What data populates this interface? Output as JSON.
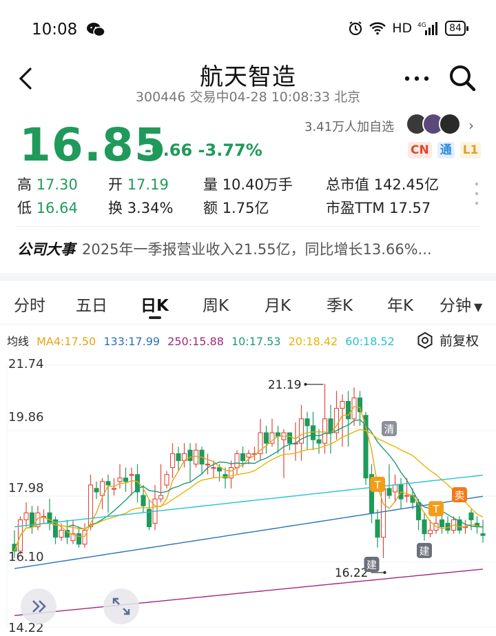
{
  "status_bar": {
    "time": "10:08",
    "network": "HD",
    "battery": "84"
  },
  "header": {
    "title": "航天智造",
    "subtitle": "300446 交易中04-28 10:08:33 北京"
  },
  "quote": {
    "price": "16.85",
    "change": "-0.66 -3.77%",
    "followers": "3.41万人加自选",
    "badges": [
      "CN",
      "通",
      "L1"
    ],
    "metrics": {
      "high_label": "高",
      "high": "17.30",
      "open_label": "开",
      "open": "17.19",
      "volume_label": "量",
      "volume": "10.40万手",
      "mktcap_label": "总市值",
      "mktcap": "142.45亿",
      "low_label": "低",
      "low": "16.64",
      "turnover_label": "换",
      "turnover": "3.34%",
      "amount_label": "额",
      "amount": "1.75亿",
      "pe_label": "市盈TTM",
      "pe": "17.57"
    }
  },
  "news": {
    "tag": "公司大事",
    "text": "2025年一季报营业收入21.55亿，同比增长13.66%..."
  },
  "tabs": [
    "分时",
    "五日",
    "日K",
    "周K",
    "月K",
    "季K",
    "年K",
    "分钟"
  ],
  "active_tab": "日K",
  "ma_legend": {
    "label": "均线",
    "items": [
      {
        "text": "MA4:17.50",
        "color": "#e8a317"
      },
      {
        "text": "133:17.99",
        "color": "#2a73b8"
      },
      {
        "text": "250:15.88",
        "color": "#a3287a"
      },
      {
        "text": "10:17.53",
        "color": "#1a9a7a"
      },
      {
        "text": "20:18.42",
        "color": "#e8b300"
      },
      {
        "text": "60:18.52",
        "color": "#27c2cf"
      }
    ],
    "restore_label": "前复权"
  },
  "chart_data": {
    "type": "candlestick",
    "y_ticks": [
      "21.74",
      "19.86",
      "17.98",
      "16.10",
      "14.22"
    ],
    "ylim": [
      14.22,
      21.74
    ],
    "annotations": [
      {
        "text": "21.19"
      },
      {
        "text": "16.22"
      }
    ],
    "markers": [
      "清",
      "T",
      "T",
      "卖",
      "建",
      "建"
    ],
    "colors": {
      "up": "#e0463a",
      "down": "#1f9a5a"
    },
    "candles": [
      [
        16.6,
        16.4,
        17.0,
        16.2
      ],
      [
        16.4,
        17.3,
        17.4,
        16.3
      ],
      [
        17.3,
        17.5,
        17.8,
        17.1
      ],
      [
        17.5,
        17.1,
        17.7,
        16.9
      ],
      [
        17.1,
        17.5,
        17.7,
        17.0
      ],
      [
        17.4,
        17.4,
        17.6,
        17.2
      ],
      [
        17.5,
        17.2,
        17.9,
        17.0
      ],
      [
        17.3,
        16.8,
        17.4,
        16.6
      ],
      [
        16.8,
        17.0,
        17.2,
        16.7
      ],
      [
        17.0,
        16.8,
        17.3,
        16.6
      ],
      [
        16.7,
        16.9,
        17.3,
        16.6
      ],
      [
        16.9,
        16.6,
        17.1,
        16.5
      ],
      [
        16.6,
        17.0,
        17.2,
        16.5
      ],
      [
        17.1,
        18.3,
        18.6,
        17.0
      ],
      [
        18.2,
        18.1,
        18.4,
        17.9
      ],
      [
        18.0,
        18.4,
        18.5,
        17.6
      ],
      [
        18.4,
        18.3,
        18.6,
        17.5
      ],
      [
        18.2,
        18.2,
        18.5,
        18.0
      ],
      [
        18.4,
        18.5,
        18.9,
        18.2
      ],
      [
        18.5,
        18.4,
        18.8,
        18.1
      ],
      [
        18.6,
        18.6,
        18.8,
        18.0
      ],
      [
        18.6,
        18.1,
        18.9,
        17.8
      ],
      [
        18.0,
        17.7,
        18.3,
        17.5
      ],
      [
        17.6,
        17.1,
        17.9,
        17.0
      ],
      [
        17.2,
        17.9,
        18.3,
        17.0
      ],
      [
        17.9,
        18.0,
        18.9,
        17.8
      ],
      [
        18.3,
        18.6,
        18.7,
        18.2
      ],
      [
        18.8,
        19.2,
        19.5,
        18.5
      ],
      [
        19.2,
        19.0,
        19.4,
        18.7
      ],
      [
        19.0,
        19.2,
        19.5,
        18.8
      ],
      [
        19.3,
        19.0,
        19.5,
        18.4
      ],
      [
        18.9,
        19.3,
        19.5,
        18.8
      ],
      [
        19.3,
        18.9,
        19.4,
        18.6
      ],
      [
        18.9,
        18.9,
        19.2,
        18.6
      ],
      [
        18.8,
        18.8,
        19.0,
        18.5
      ],
      [
        18.8,
        18.7,
        18.9,
        18.4
      ],
      [
        18.6,
        18.5,
        18.8,
        18.2
      ],
      [
        18.5,
        18.8,
        19.0,
        18.2
      ],
      [
        18.8,
        19.2,
        19.3,
        18.6
      ],
      [
        19.2,
        19.0,
        19.4,
        18.8
      ],
      [
        19.1,
        19.2,
        19.3,
        18.9
      ],
      [
        19.2,
        19.2,
        19.4,
        19.0
      ],
      [
        19.2,
        19.8,
        20.2,
        19.0
      ],
      [
        19.8,
        19.5,
        20.0,
        19.2
      ],
      [
        19.5,
        19.8,
        20.2,
        19.4
      ],
      [
        19.8,
        19.7,
        20.0,
        19.2
      ],
      [
        19.6,
        19.8,
        19.9,
        18.5
      ],
      [
        19.8,
        19.5,
        19.8,
        19.3
      ],
      [
        19.5,
        19.5,
        20.1,
        19.0
      ],
      [
        19.5,
        20.2,
        20.6,
        19.0
      ],
      [
        20.2,
        20.0,
        20.4,
        19.3
      ],
      [
        20.0,
        19.6,
        20.4,
        19.3
      ],
      [
        19.6,
        19.5,
        19.9,
        19.2
      ],
      [
        19.5,
        20.2,
        21.2,
        19.2
      ],
      [
        20.2,
        19.8,
        20.6,
        19.2
      ],
      [
        19.8,
        20.5,
        21.0,
        19.6
      ],
      [
        20.5,
        20.7,
        20.9,
        19.4
      ],
      [
        20.7,
        20.2,
        21.0,
        19.4
      ],
      [
        20.2,
        20.8,
        21.1,
        20.0
      ],
      [
        20.8,
        20.4,
        21.0,
        20.0
      ],
      [
        20.3,
        18.5,
        20.4,
        18.3
      ],
      [
        18.6,
        17.5,
        18.9,
        17.2
      ],
      [
        17.3,
        16.8,
        17.6,
        16.5
      ],
      [
        16.8,
        18.2,
        18.4,
        16.2
      ],
      [
        18.2,
        18.0,
        18.9,
        17.9
      ],
      [
        18.1,
        18.3,
        18.6,
        17.8
      ],
      [
        18.3,
        17.9,
        18.5,
        17.6
      ],
      [
        18.0,
        18.0,
        18.5,
        17.8
      ],
      [
        18.0,
        17.8,
        18.2,
        17.6
      ],
      [
        17.8,
        17.3,
        17.9,
        17.0
      ],
      [
        17.3,
        16.9,
        17.5,
        16.7
      ],
      [
        16.9,
        17.0,
        17.3,
        16.8
      ],
      [
        17.0,
        17.2,
        17.5,
        16.9
      ],
      [
        17.3,
        17.1,
        17.5,
        16.9
      ],
      [
        17.2,
        17.0,
        17.4,
        16.9
      ],
      [
        17.0,
        17.3,
        17.4,
        16.9
      ],
      [
        17.3,
        17.0,
        17.4,
        16.9
      ],
      [
        17.1,
        17.1,
        17.3,
        16.9
      ],
      [
        17.5,
        17.3,
        17.6,
        17.0
      ],
      [
        17.2,
        17.1,
        17.4,
        16.9
      ],
      [
        16.9,
        16.85,
        17.3,
        16.64
      ]
    ]
  }
}
